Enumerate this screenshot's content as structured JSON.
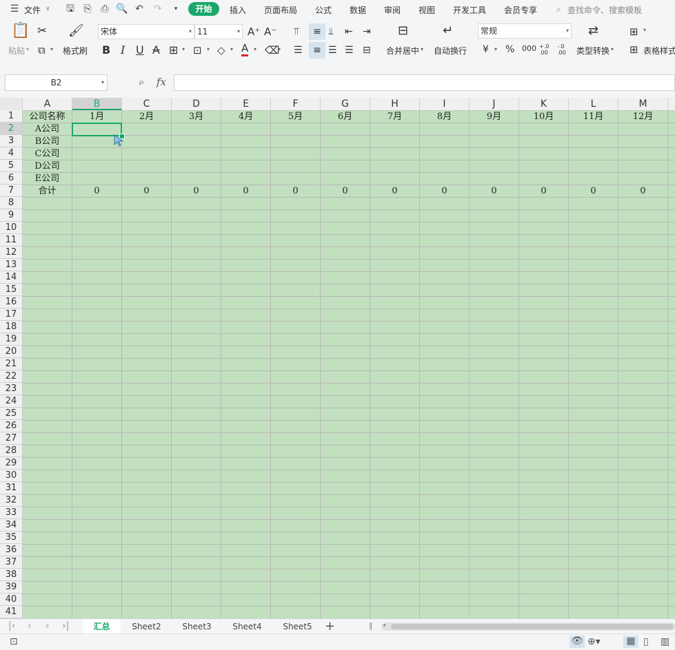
{
  "menubar": {
    "file": "文件",
    "tabs": [
      "开始",
      "插入",
      "页面布局",
      "公式",
      "数据",
      "审阅",
      "视图",
      "开发工具",
      "会员专享"
    ],
    "search_placeholder": "查找命令、搜索模板"
  },
  "ribbon": {
    "paste": "粘贴",
    "format_painter": "格式刷",
    "font_name": "宋体",
    "font_size": "11",
    "merge_center": "合并居中",
    "auto_wrap": "自动换行",
    "number_format": "常规",
    "type_convert": "类型转换",
    "table_style": "表格样式",
    "percent": "%",
    "yen": "¥",
    "thousands": "000",
    "dec_inc": "+.0\n.00",
    "dec_dec": "-.0\n.00"
  },
  "formula_bar": {
    "name_box": "B2",
    "fx": "fx",
    "value": ""
  },
  "grid": {
    "columns": [
      "A",
      "B",
      "C",
      "D",
      "E",
      "F",
      "G",
      "H",
      "I",
      "J",
      "K",
      "L",
      "M"
    ],
    "active_column": "B",
    "active_row": 2,
    "rows": [
      "1",
      "2",
      "3",
      "4",
      "5",
      "6",
      "7",
      "8",
      "9",
      "10",
      "11",
      "12",
      "13",
      "14",
      "15",
      "16",
      "17",
      "18",
      "19",
      "20",
      "21",
      "22",
      "23",
      "24",
      "25",
      "26",
      "27",
      "28",
      "29",
      "30",
      "31",
      "32",
      "33",
      "34",
      "35",
      "36",
      "37",
      "38",
      "39",
      "40",
      "41"
    ],
    "header_row": [
      "公司名称",
      "1月",
      "2月",
      "3月",
      "4月",
      "5月",
      "6月",
      "7月",
      "8月",
      "9月",
      "10月",
      "11月",
      "12月"
    ],
    "companies": [
      "A公司",
      "B公司",
      "C公司",
      "D公司",
      "E公司"
    ],
    "total_label": "合计",
    "totals": [
      "0",
      "0",
      "0",
      "0",
      "0",
      "0",
      "0",
      "0",
      "0",
      "0",
      "0",
      "0"
    ]
  },
  "sheet_tabs": {
    "tabs": [
      "汇总",
      "Sheet2",
      "Sheet3",
      "Sheet4",
      "Sheet5"
    ],
    "active": "汇总",
    "add": "+"
  },
  "colors": {
    "accent": "#1aa86a",
    "cell_bg": "#c2e0bf"
  }
}
